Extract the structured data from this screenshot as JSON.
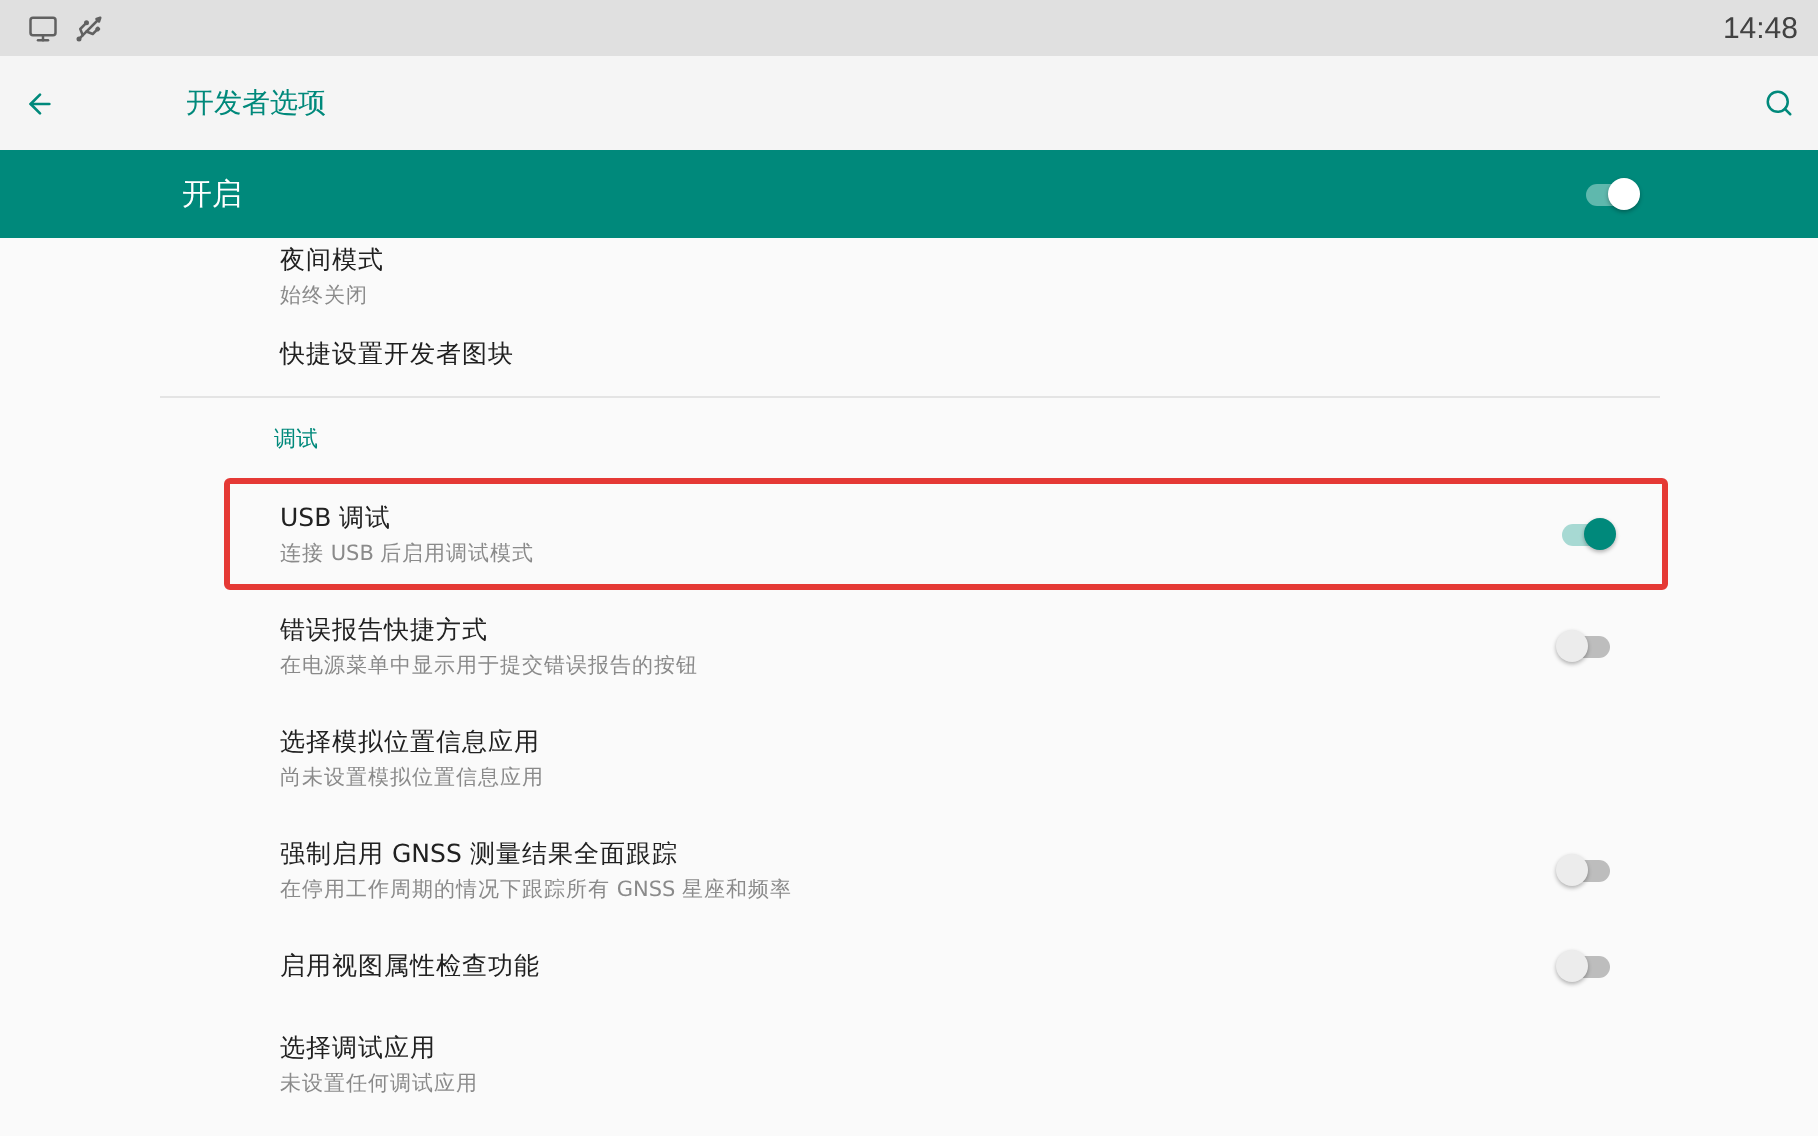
{
  "status_bar": {
    "time": "14:48"
  },
  "toolbar": {
    "title": "开发者选项"
  },
  "master_switch": {
    "label": "开启",
    "checked": true
  },
  "items": [
    {
      "kind": "item",
      "title": "夜间模式",
      "summary": "始终关闭"
    },
    {
      "kind": "item",
      "title": "快捷设置开发者图块",
      "divider": true
    },
    {
      "kind": "category",
      "title": "调试"
    },
    {
      "kind": "item",
      "title": "USB 调试",
      "summary": "连接 USB 后启用调试模式",
      "checked": true,
      "highlighted": true
    },
    {
      "kind": "item",
      "title": "错误报告快捷方式",
      "summary": "在电源菜单中显示用于提交错误报告的按钮",
      "checked": false
    },
    {
      "kind": "item",
      "title": "选择模拟位置信息应用",
      "summary": "尚未设置模拟位置信息应用"
    },
    {
      "kind": "item",
      "title": "强制启用 GNSS 测量结果全面跟踪",
      "summary": "在停用工作周期的情况下跟踪所有 GNSS 星座和频率",
      "checked": false
    },
    {
      "kind": "item",
      "title": "启用视图属性检查功能",
      "checked": false
    },
    {
      "kind": "item",
      "title": "选择调试应用",
      "summary": "未设置任何调试应用"
    }
  ]
}
